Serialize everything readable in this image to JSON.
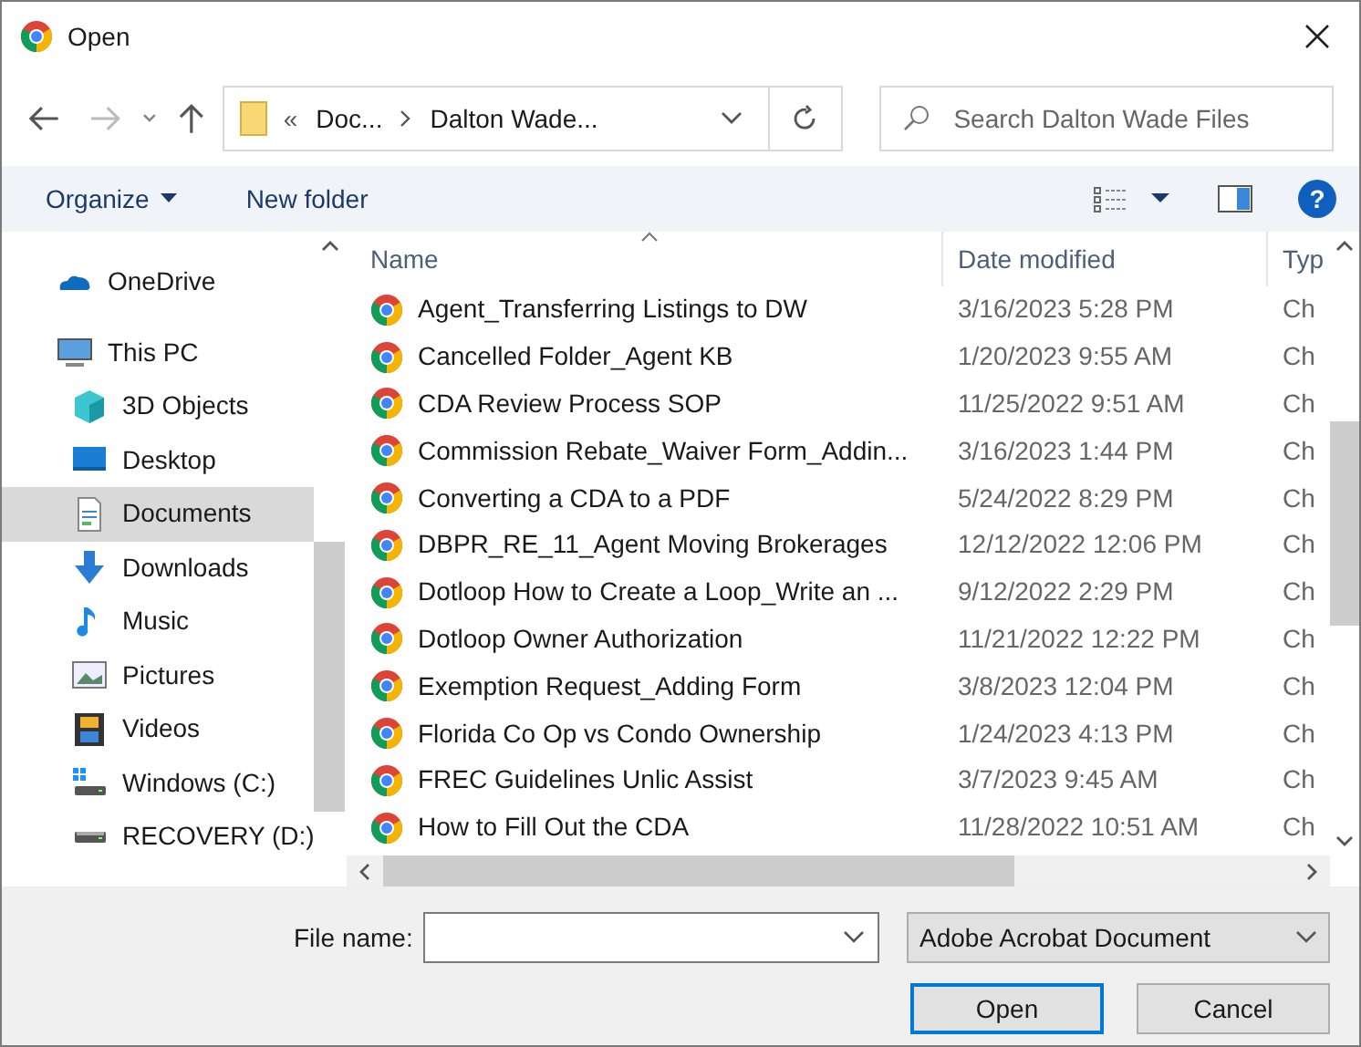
{
  "window": {
    "title": "Open"
  },
  "address": {
    "overflow": "«",
    "crumbs": [
      "Doc...",
      "Dalton Wade..."
    ]
  },
  "search": {
    "placeholder": "Search Dalton Wade Files"
  },
  "toolbar": {
    "organize": "Organize",
    "new_folder": "New folder",
    "help": "?"
  },
  "sidebar": {
    "items": [
      {
        "label": "OneDrive",
        "kind": "cloud",
        "selected": false
      },
      {
        "label": "This PC",
        "kind": "computer",
        "selected": false,
        "children": [
          {
            "label": "3D Objects",
            "kind": "cube",
            "selected": false
          },
          {
            "label": "Desktop",
            "kind": "desktop",
            "selected": false
          },
          {
            "label": "Documents",
            "kind": "document",
            "selected": true
          },
          {
            "label": "Downloads",
            "kind": "download",
            "selected": false
          },
          {
            "label": "Music",
            "kind": "music",
            "selected": false
          },
          {
            "label": "Pictures",
            "kind": "pictures",
            "selected": false
          },
          {
            "label": "Videos",
            "kind": "videos",
            "selected": false
          },
          {
            "label": "Windows (C:)",
            "kind": "windrive",
            "selected": false
          },
          {
            "label": "RECOVERY (D:)",
            "kind": "drive",
            "selected": false
          }
        ]
      }
    ]
  },
  "table": {
    "columns": [
      "Name",
      "Date modified",
      "Typ"
    ],
    "rows": [
      {
        "name": "Agent_Transferring Listings to DW",
        "date": "3/16/2023 5:28 PM",
        "type": "Ch"
      },
      {
        "name": "Cancelled Folder_Agent KB",
        "date": "1/20/2023 9:55 AM",
        "type": "Ch"
      },
      {
        "name": "CDA Review Process SOP",
        "date": "11/25/2022 9:51 AM",
        "type": "Ch"
      },
      {
        "name": "Commission Rebate_Waiver Form_Addin...",
        "date": "3/16/2023 1:44 PM",
        "type": "Ch"
      },
      {
        "name": "Converting a CDA to a PDF",
        "date": "5/24/2022 8:29 PM",
        "type": "Ch"
      },
      {
        "name": "DBPR_RE_11_Agent Moving Brokerages",
        "date": "12/12/2022 12:06 PM",
        "type": "Ch"
      },
      {
        "name": "Dotloop How to Create a Loop_Write an ...",
        "date": "9/12/2022 2:29 PM",
        "type": "Ch"
      },
      {
        "name": "Dotloop Owner Authorization",
        "date": "11/21/2022 12:22 PM",
        "type": "Ch"
      },
      {
        "name": "Exemption Request_Adding Form",
        "date": "3/8/2023 12:04 PM",
        "type": "Ch"
      },
      {
        "name": "Florida Co Op vs Condo Ownership",
        "date": "1/24/2023 4:13 PM",
        "type": "Ch"
      },
      {
        "name": "FREC Guidelines Unlic Assist",
        "date": "3/7/2023 9:45 AM",
        "type": "Ch"
      },
      {
        "name": "How to Fill Out the CDA",
        "date": "11/28/2022 10:51 AM",
        "type": "Ch"
      }
    ]
  },
  "footer": {
    "file_name_label": "File name:",
    "file_type": "Adobe Acrobat Document",
    "open": "Open",
    "cancel": "Cancel"
  }
}
